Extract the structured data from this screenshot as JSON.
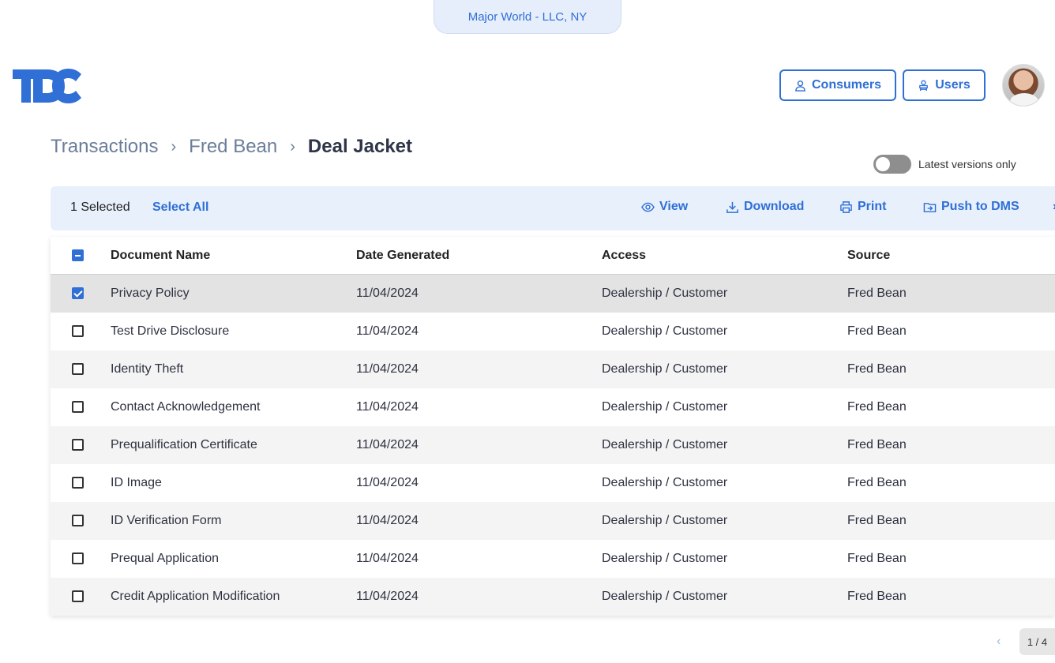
{
  "org": {
    "name": "Major World - LLC, NY"
  },
  "brand": {
    "logo_text": "TDC",
    "logo_color": "#2f6fd6"
  },
  "header": {
    "consumers_label": "Consumers",
    "users_label": "Users",
    "consumers_icon": "person-icon",
    "users_icon": "users-icon"
  },
  "breadcrumb": {
    "items": [
      "Transactions",
      "Fred Bean"
    ],
    "separator": "›",
    "current": "Deal Jacket"
  },
  "filters": {
    "latest_versions_label": "Latest versions only",
    "latest_versions_on": false
  },
  "toolbar": {
    "selected_text": "1 Selected",
    "select_all_label": "Select All",
    "view_label": "View",
    "download_label": "Download",
    "print_label": "Print",
    "push_label": "Push to DMS",
    "more_label": "›"
  },
  "table": {
    "columns": [
      "Document Name",
      "Date Generated",
      "Access",
      "Source"
    ],
    "rows": [
      {
        "name": "Privacy Policy",
        "date": "11/04/2024",
        "access": "Dealership / Customer",
        "source": "Fred Bean",
        "checked": true
      },
      {
        "name": "Test Drive Disclosure",
        "date": "11/04/2024",
        "access": "Dealership / Customer",
        "source": "Fred Bean",
        "checked": false
      },
      {
        "name": "Identity Theft",
        "date": "11/04/2024",
        "access": "Dealership / Customer",
        "source": "Fred Bean",
        "checked": false
      },
      {
        "name": "Contact Acknowledgement",
        "date": "11/04/2024",
        "access": "Dealership / Customer",
        "source": "Fred Bean",
        "checked": false
      },
      {
        "name": "Prequalification Certificate",
        "date": "11/04/2024",
        "access": "Dealership / Customer",
        "source": "Fred Bean",
        "checked": false
      },
      {
        "name": "ID Image",
        "date": "11/04/2024",
        "access": "Dealership / Customer",
        "source": "Fred Bean",
        "checked": false
      },
      {
        "name": "ID Verification Form",
        "date": "11/04/2024",
        "access": "Dealership / Customer",
        "source": "Fred Bean",
        "checked": false
      },
      {
        "name": "Prequal Application",
        "date": "11/04/2024",
        "access": "Dealership / Customer",
        "source": "Fred Bean",
        "checked": false
      },
      {
        "name": "Credit Application Modification",
        "date": "11/04/2024",
        "access": "Dealership / Customer",
        "source": "Fred Bean",
        "checked": false
      }
    ]
  },
  "pagination": {
    "prev_label": "‹",
    "label": "1 / 4"
  }
}
